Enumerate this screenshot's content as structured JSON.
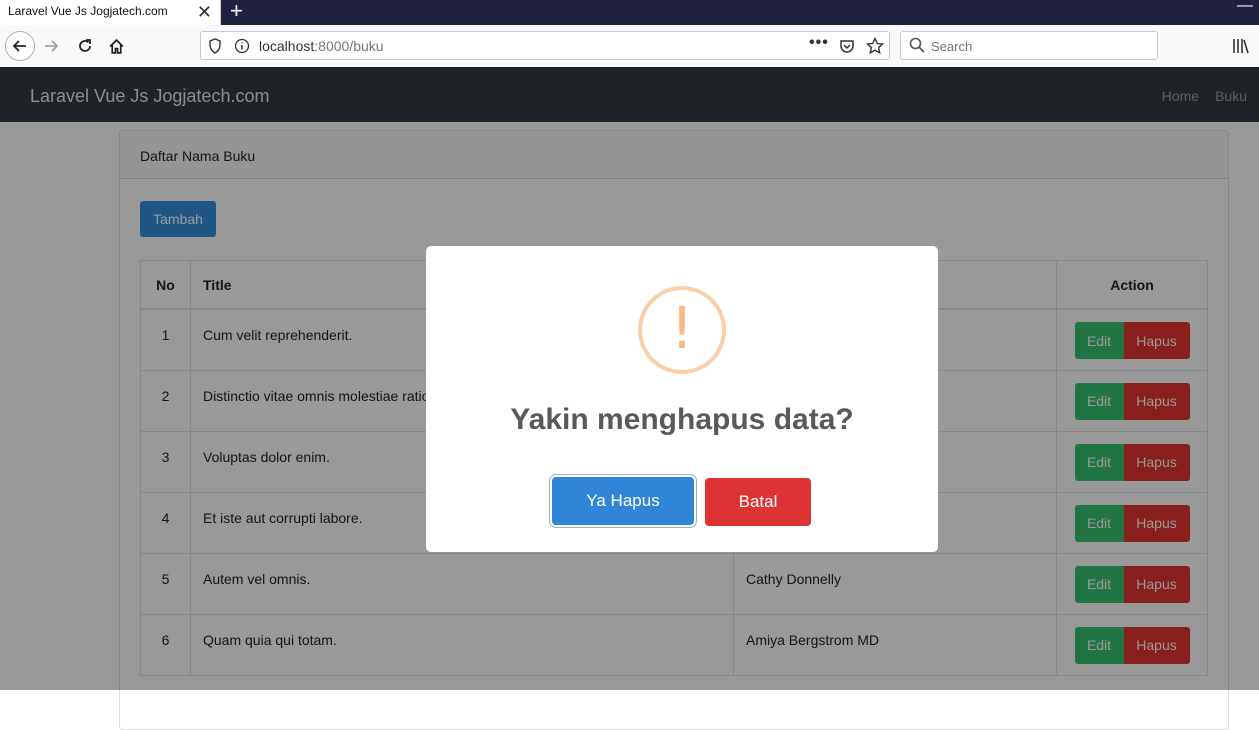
{
  "browser": {
    "tab_title": "Laravel Vue Js Jogjatech.com",
    "tab_close": "✕",
    "new_tab": "+",
    "url_host": "localhost",
    "url_path": ":8000/buku",
    "url_more": "•••",
    "search_placeholder": "Search",
    "window_minimize": "—"
  },
  "app": {
    "brand": "Laravel Vue Js Jogjatech.com",
    "nav": [
      "Home",
      "Buku"
    ]
  },
  "card": {
    "header": "Daftar Nama Buku",
    "add_button": "Tambah"
  },
  "table": {
    "columns": [
      "No",
      "Title",
      "",
      "Action"
    ],
    "rows": [
      {
        "no": "1",
        "title": "Cum velit reprehenderit.",
        "author": ""
      },
      {
        "no": "2",
        "title": "Distinctio vitae omnis molestiae ratio",
        "author": ""
      },
      {
        "no": "3",
        "title": "Voluptas dolor enim.",
        "author": ""
      },
      {
        "no": "4",
        "title": "Et iste aut corrupti labore.",
        "author": ""
      },
      {
        "no": "5",
        "title": "Autem vel omnis.",
        "author": "Cathy Donnelly"
      },
      {
        "no": "6",
        "title": "Quam quia qui totam.",
        "author": "Amiya Bergstrom MD"
      }
    ],
    "edit_label": "Edit",
    "delete_label": "Hapus"
  },
  "modal": {
    "icon": "!",
    "title": "Yakin menghapus data?",
    "confirm_label": "Ya Hapus",
    "cancel_label": "Batal"
  },
  "colors": {
    "primary": "#3490dc",
    "success": "#38c172",
    "danger": "#e3342f",
    "navbar": "#343a40",
    "confirm": "#3085d6",
    "cancel": "#dd3333",
    "warning": "#f8bb86"
  }
}
